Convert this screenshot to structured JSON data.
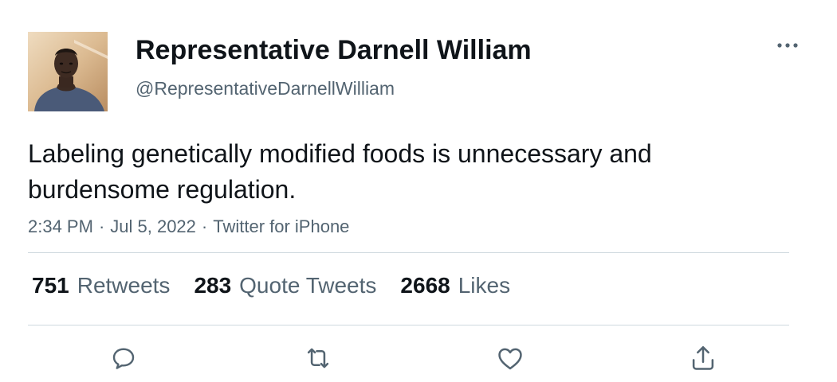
{
  "tweet": {
    "author": {
      "display_name": "Representative Darnell William",
      "handle": "@RepresentativeDarnellWilliam"
    },
    "text": "Labeling genetically modified foods is unnecessary and burdensome regulation.",
    "meta": {
      "time": "2:34 PM",
      "separator": "·",
      "date": "Jul 5, 2022",
      "source": "Twitter for iPhone"
    },
    "stats": {
      "retweets": {
        "count": "751",
        "label": "Retweets"
      },
      "quotes": {
        "count": "283",
        "label": "Quote Tweets"
      },
      "likes": {
        "count": "2668",
        "label": "Likes"
      }
    }
  },
  "icons": {
    "more": "more-horizontal-icon",
    "reply": "reply-icon",
    "retweet": "retweet-icon",
    "like": "heart-icon",
    "share": "share-icon"
  },
  "colors": {
    "text_primary": "#0f1419",
    "text_secondary": "#536471",
    "divider": "#cfd9de"
  }
}
